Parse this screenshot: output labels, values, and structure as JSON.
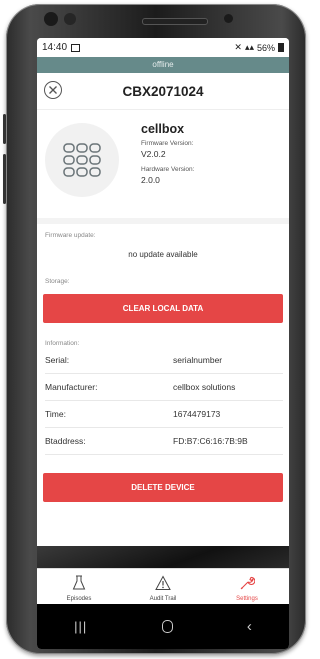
{
  "status_bar": {
    "time": "14:40",
    "battery": "56%"
  },
  "connection_banner": "offline",
  "header": {
    "title": "CBX2071024"
  },
  "device": {
    "name": "cellbox",
    "firmware_label": "Firmware Version:",
    "firmware_value": "V2.0.2",
    "hardware_label": "Hardware Version:",
    "hardware_value": "2.0.0"
  },
  "firmware_update": {
    "label": "Firmware update:",
    "status": "no update available"
  },
  "storage": {
    "label": "Storage:",
    "clear_button": "CLEAR LOCAL DATA"
  },
  "information": {
    "label": "Information:",
    "rows": [
      {
        "key": "Serial:",
        "value": "serialnumber"
      },
      {
        "key": "Manufacturer:",
        "value": "cellbox solutions"
      },
      {
        "key": "Time:",
        "value": "1674479173"
      },
      {
        "key": "Btaddress:",
        "value": "FD:B7:C6:16:7B:9B"
      }
    ]
  },
  "delete_button": "DELETE DEVICE",
  "tabs": [
    {
      "label": "Episodes",
      "icon": "flask-icon"
    },
    {
      "label": "Audit Trail",
      "icon": "warning-icon"
    },
    {
      "label": "Settings",
      "icon": "wrench-icon",
      "active": true
    }
  ],
  "colors": {
    "accent": "#e54646",
    "banner": "#668a8a"
  }
}
